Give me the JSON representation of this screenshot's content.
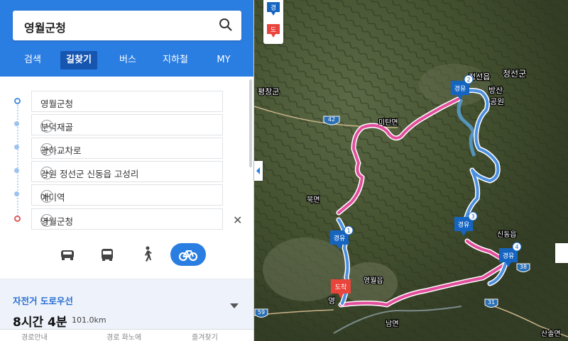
{
  "search": {
    "query": "영월군청"
  },
  "tabs": [
    {
      "label": "검색"
    },
    {
      "label": "길찾기"
    },
    {
      "label": "버스"
    },
    {
      "label": "지하철"
    },
    {
      "label": "MY"
    }
  ],
  "waypoints": [
    {
      "label": "영월군청",
      "role": "start"
    },
    {
      "label": "분덕재골",
      "role": "via",
      "action": "−"
    },
    {
      "label": "광하교차로",
      "role": "via",
      "action": "−"
    },
    {
      "label": "강원 정선군 신동읍 고성리",
      "role": "via",
      "action": "−"
    },
    {
      "label": "예미역",
      "role": "via",
      "action": "−"
    },
    {
      "label": "영월군청",
      "role": "end",
      "action": "+"
    }
  ],
  "close_symbol": "✕",
  "modes": [
    {
      "name": "car-icon"
    },
    {
      "name": "bus-icon"
    },
    {
      "name": "walk-icon"
    },
    {
      "name": "bicycle-icon",
      "active": true
    }
  ],
  "summary": {
    "route_label": "자전거 도로우선",
    "duration": "8시간 4분",
    "distance": "101.0km",
    "footer": [
      "경로안내",
      "경로 화노에",
      "즐겨찾기"
    ]
  },
  "legend": {
    "via_badge": "경",
    "dest_badge": "도"
  },
  "map": {
    "labels": {
      "pyeongchang": "평창군",
      "jeongseon_eup": "정선읍",
      "jeongseon_gun": "정선군",
      "bangsan": "방산",
      "park": "공원",
      "mitan": "미탄면",
      "buk": "북면",
      "sindong": "신동읍",
      "yeongwol_eup": "영월읍",
      "nam": "남면",
      "young": "영",
      "sandong": "산솔면"
    },
    "roads": [
      "42",
      "59",
      "31",
      "38"
    ],
    "markers": [
      {
        "num": "1",
        "text": "경유"
      },
      {
        "num": "2",
        "text": "경유"
      },
      {
        "num": "3",
        "text": "경유"
      },
      {
        "num": "4",
        "text": "경유"
      },
      {
        "text": "도착"
      }
    ],
    "colors": {
      "route_pink": "#e24e9c",
      "route_blue": "#4b8fe0",
      "marker_blue": "#1565c0",
      "marker_red": "#e8453c",
      "accent": "#2a7de1"
    }
  }
}
